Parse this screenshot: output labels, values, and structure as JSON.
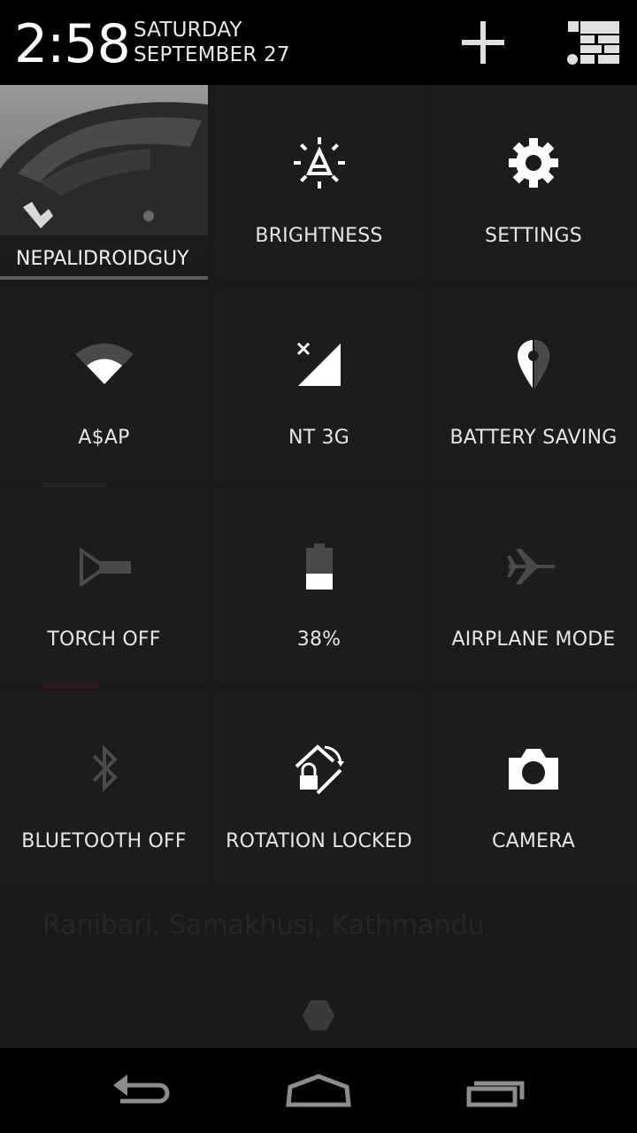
{
  "status_header": {
    "time": "2:58",
    "day": "SATURDAY",
    "date": "SEPTEMBER 27",
    "add_icon": "plus-icon",
    "settings_list_icon": "notification-list-icon"
  },
  "quick_settings": {
    "user": {
      "name": "NEPALIDROIDGUY",
      "icon": "user-photo"
    },
    "tiles": [
      {
        "label": "BRIGHTNESS",
        "icon": "brightness-auto-icon"
      },
      {
        "label": "SETTINGS",
        "icon": "gear-icon"
      },
      {
        "label": "A$AP",
        "icon": "wifi-icon"
      },
      {
        "label": "NT 3G",
        "icon": "signal-no-data-icon"
      },
      {
        "label": "BATTERY SAVING",
        "icon": "location-icon"
      },
      {
        "label": "TORCH OFF",
        "icon": "torch-icon"
      },
      {
        "label": "38%",
        "icon": "battery-icon",
        "level": 0.38
      },
      {
        "label": "AIRPLANE MODE",
        "icon": "airplane-icon"
      },
      {
        "label": "BLUETOOTH OFF",
        "icon": "bluetooth-icon"
      },
      {
        "label": "ROTATION LOCKED",
        "icon": "rotation-lock-icon"
      },
      {
        "label": "CAMERA",
        "icon": "camera-icon"
      }
    ]
  },
  "background": {
    "location_text": "Ranibari, Samakhusi, Kathmandu"
  },
  "navigation": {
    "back_icon": "back-icon",
    "home_icon": "home-icon",
    "recents_icon": "recents-icon"
  },
  "colors": {
    "panel": "#1c1c1c",
    "header": "#000000",
    "icon_active": "#ffffff",
    "icon_inactive": "#4a4a4a"
  }
}
